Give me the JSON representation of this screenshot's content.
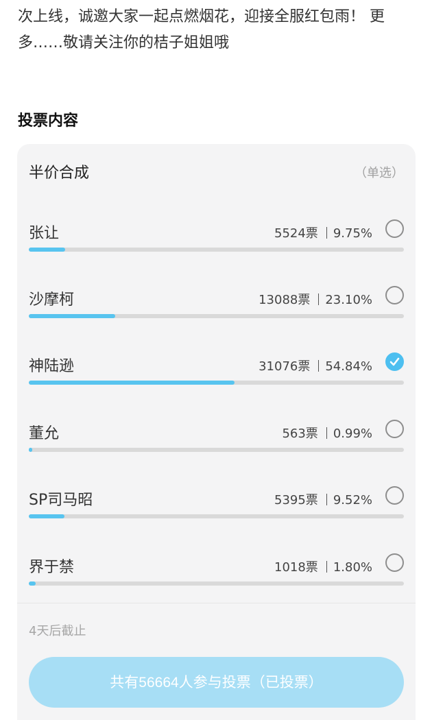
{
  "intro_text": "次上线，诚邀大家一起点燃烟花，迎接全服红包雨！ 更多……敬请关注你的桔子姐姐哦",
  "section_title": "投票内容",
  "vote": {
    "title": "半价合成",
    "type_label": "（单选）",
    "options": [
      {
        "name": "张让",
        "votes": "5524票",
        "percent": "9.75%",
        "fraction": 0.0975,
        "selected": false
      },
      {
        "name": "沙摩柯",
        "votes": "13088票",
        "percent": "23.10%",
        "fraction": 0.231,
        "selected": false
      },
      {
        "name": "神陆逊",
        "votes": "31076票",
        "percent": "54.84%",
        "fraction": 0.5484,
        "selected": true
      },
      {
        "name": "董允",
        "votes": "563票",
        "percent": "0.99%",
        "fraction": 0.0099,
        "selected": false
      },
      {
        "name": "SP司马昭",
        "votes": "5395票",
        "percent": "9.52%",
        "fraction": 0.0952,
        "selected": false
      },
      {
        "name": "界于禁",
        "votes": "1018票",
        "percent": "1.80%",
        "fraction": 0.018,
        "selected": false
      }
    ],
    "deadline": "4天后截止",
    "button_label": "共有56664人参与投票（已投票）"
  },
  "colors": {
    "accent": "#4dbff0",
    "bar_fill": "#58c4ef",
    "button_bg": "#a7def5"
  },
  "icons": {
    "unchecked": "radio-unchecked-icon",
    "checked": "check-circle-icon"
  }
}
